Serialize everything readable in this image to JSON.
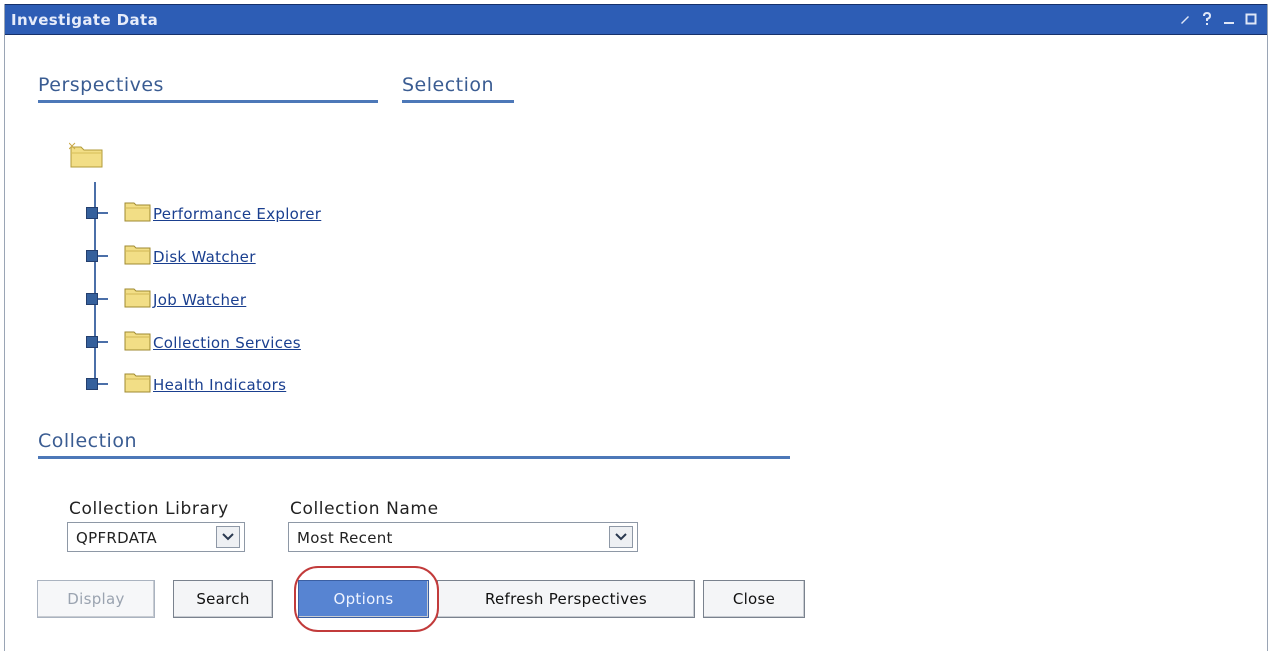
{
  "window": {
    "title": "Investigate Data",
    "controls": [
      "edit-icon",
      "help-icon",
      "minimize-icon",
      "maximize-icon"
    ],
    "title_controls_text": [
      "✎",
      "?",
      "–",
      "☐"
    ]
  },
  "sections": {
    "perspectives": "Perspectives",
    "selection": "Selection",
    "collection": "Collection"
  },
  "tree": {
    "items": [
      {
        "label": "Performance Explorer"
      },
      {
        "label": "Disk Watcher"
      },
      {
        "label": "Job Watcher"
      },
      {
        "label": "Collection Services"
      },
      {
        "label": "Health Indicators"
      }
    ]
  },
  "collection": {
    "library_label": "Collection Library",
    "library_value": "QPFRDATA",
    "name_label": "Collection Name",
    "name_value": "Most Recent"
  },
  "buttons": {
    "display": "Display",
    "search": "Search",
    "options": "Options",
    "refresh": "Refresh Perspectives",
    "close": "Close"
  },
  "colors": {
    "titlebar": "#2d5db5",
    "accent": "#4d78b8",
    "highlight": "#c23b3b"
  }
}
